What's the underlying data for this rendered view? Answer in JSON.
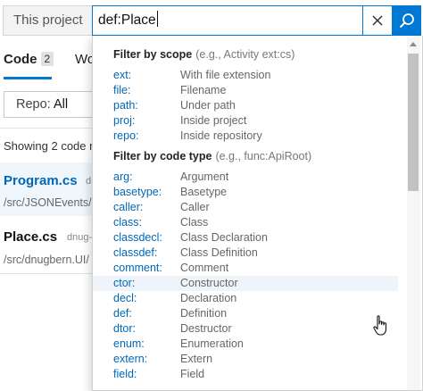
{
  "search": {
    "scope_label": "This project",
    "query": "def:Place"
  },
  "icons": {
    "clear": "close-icon",
    "search": "search-icon",
    "scroll_up": "chevron-up-icon",
    "cursor": "hand-pointer-icon"
  },
  "colors": {
    "accent": "#0078d4",
    "keyword": "#0067b8",
    "hover_row": "#eef4fa"
  },
  "page": {
    "tabs": [
      {
        "label": "Code",
        "count": "2"
      },
      {
        "label": "Wo"
      }
    ],
    "repo_filter": {
      "prefix": "Repo:",
      "value": "All"
    },
    "showing_text": "Showing 2 code r",
    "results": [
      {
        "title": "Program.cs",
        "meta": "dn",
        "path": "/src/JSONEvents/."
      },
      {
        "title": "Place.cs",
        "meta": "dnug-",
        "path": "/src/dnugbern.UI/"
      }
    ]
  },
  "dropdown": {
    "scope_section": {
      "title": "Filter by scope",
      "hint": "(e.g., Activity ext:cs)",
      "items": [
        {
          "keyword": "ext:",
          "description": "With file extension"
        },
        {
          "keyword": "file:",
          "description": "Filename"
        },
        {
          "keyword": "path:",
          "description": "Under path"
        },
        {
          "keyword": "proj:",
          "description": "Inside project"
        },
        {
          "keyword": "repo:",
          "description": "Inside repository"
        }
      ]
    },
    "type_section": {
      "title": "Filter by code type",
      "hint": "(e.g., func:ApiRoot)",
      "items": [
        {
          "keyword": "arg:",
          "description": "Argument"
        },
        {
          "keyword": "basetype:",
          "description": "Basetype"
        },
        {
          "keyword": "caller:",
          "description": "Caller"
        },
        {
          "keyword": "class:",
          "description": "Class"
        },
        {
          "keyword": "classdecl:",
          "description": "Class Declaration"
        },
        {
          "keyword": "classdef:",
          "description": "Class Definition"
        },
        {
          "keyword": "comment:",
          "description": "Comment"
        },
        {
          "keyword": "ctor:",
          "description": "Constructor"
        },
        {
          "keyword": "decl:",
          "description": "Declaration"
        },
        {
          "keyword": "def:",
          "description": "Definition"
        },
        {
          "keyword": "dtor:",
          "description": "Destructor"
        },
        {
          "keyword": "enum:",
          "description": "Enumeration"
        },
        {
          "keyword": "extern:",
          "description": "Extern"
        },
        {
          "keyword": "field:",
          "description": "Field"
        }
      ]
    }
  }
}
